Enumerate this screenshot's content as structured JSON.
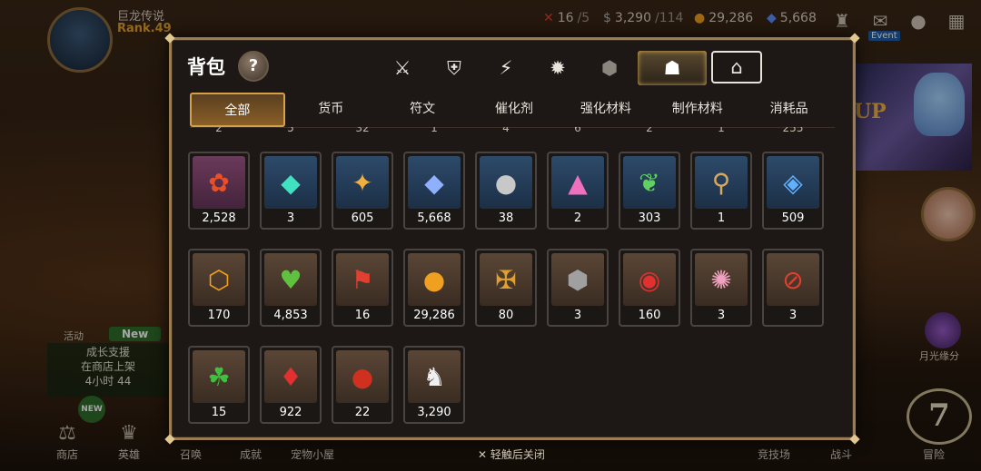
{
  "player": {
    "name": "巨龙传说",
    "rank": "Rank.49"
  },
  "resources": {
    "stamina": {
      "value": "16",
      "max": "/5"
    },
    "silver": {
      "value": "3,290",
      "max": "/114"
    },
    "gold": "29,286",
    "crystal": "5,668"
  },
  "top_right": {
    "event_label": "Event"
  },
  "left_side": {
    "activity_label": "活动",
    "new_label": "New",
    "promo_lines": [
      "成长支援",
      "在商店上架",
      "4小时 44"
    ]
  },
  "right_side": {
    "banner_text": "UP",
    "moon_label": "月光缘分",
    "big_seven": "7"
  },
  "bottom_nav": {
    "shop": "商店",
    "heroes": "英雄",
    "summon": "召唤",
    "achievement": "成就",
    "pet_house": "宠物小屋",
    "arena": "竞技场",
    "battle": "战斗",
    "adventure": "冒险",
    "new_tag": "NEW"
  },
  "panel": {
    "title": "背包",
    "help": "?",
    "sub_tabs": [
      "全部",
      "货币",
      "符文",
      "催化剂",
      "强化材料",
      "制作材料",
      "消耗品"
    ],
    "active_sub_tab": "全部",
    "partial_counts": [
      "2",
      "5",
      "32",
      "1",
      "4",
      "6",
      "2",
      "1",
      "255"
    ],
    "items": [
      {
        "icon": "✿",
        "color": "#e8502a",
        "bg": "purple",
        "count": "2,528"
      },
      {
        "icon": "◆",
        "color": "#40e0c0",
        "bg": "blue",
        "count": "3"
      },
      {
        "icon": "✦",
        "color": "#f0b040",
        "bg": "blue",
        "count": "605"
      },
      {
        "icon": "◆",
        "color": "#8fb0ff",
        "bg": "blue",
        "count": "5,668"
      },
      {
        "icon": "●",
        "color": "#c8c8c8",
        "bg": "blue",
        "count": "38"
      },
      {
        "icon": "▲",
        "color": "#f070c0",
        "bg": "blue",
        "count": "2"
      },
      {
        "icon": "❦",
        "color": "#60d060",
        "bg": "blue",
        "count": "303"
      },
      {
        "icon": "⚲",
        "color": "#d8a860",
        "bg": "blue",
        "count": "1"
      },
      {
        "icon": "◈",
        "color": "#60b0ff",
        "bg": "blue",
        "count": "509"
      },
      {
        "icon": "⬡",
        "color": "#f0a020",
        "bg": "brown",
        "count": "170"
      },
      {
        "icon": "♥",
        "color": "#60c040",
        "bg": "brown",
        "count": "4,853"
      },
      {
        "icon": "⚑",
        "color": "#e04030",
        "bg": "brown",
        "count": "16"
      },
      {
        "icon": "●",
        "color": "#f0a020",
        "bg": "brown",
        "count": "29,286"
      },
      {
        "icon": "✠",
        "color": "#e0a030",
        "bg": "brown",
        "count": "80"
      },
      {
        "icon": "⬢",
        "color": "#a0a0a0",
        "bg": "brown",
        "count": "3"
      },
      {
        "icon": "◉",
        "color": "#e03030",
        "bg": "brown",
        "count": "160"
      },
      {
        "icon": "✺",
        "color": "#f0a0c0",
        "bg": "brown",
        "count": "3"
      },
      {
        "icon": "⊘",
        "color": "#e04030",
        "bg": "brown",
        "count": "3"
      },
      {
        "icon": "☘",
        "color": "#40c040",
        "bg": "brown",
        "count": "15"
      },
      {
        "icon": "♦",
        "color": "#e03030",
        "bg": "brown",
        "count": "922"
      },
      {
        "icon": "●",
        "color": "#d03020",
        "bg": "brown",
        "count": "22"
      },
      {
        "icon": "♞",
        "color": "#f0f0f0",
        "bg": "brown",
        "count": "3,290"
      }
    ]
  },
  "close_hint": "轻触后关闭",
  "icons": {
    "category_tabs": [
      "sword-shield-icon",
      "broken-shield-icon",
      "lightning-icon",
      "burst-icon",
      "dice-icon",
      "backpack-icon",
      "house-icon"
    ]
  }
}
